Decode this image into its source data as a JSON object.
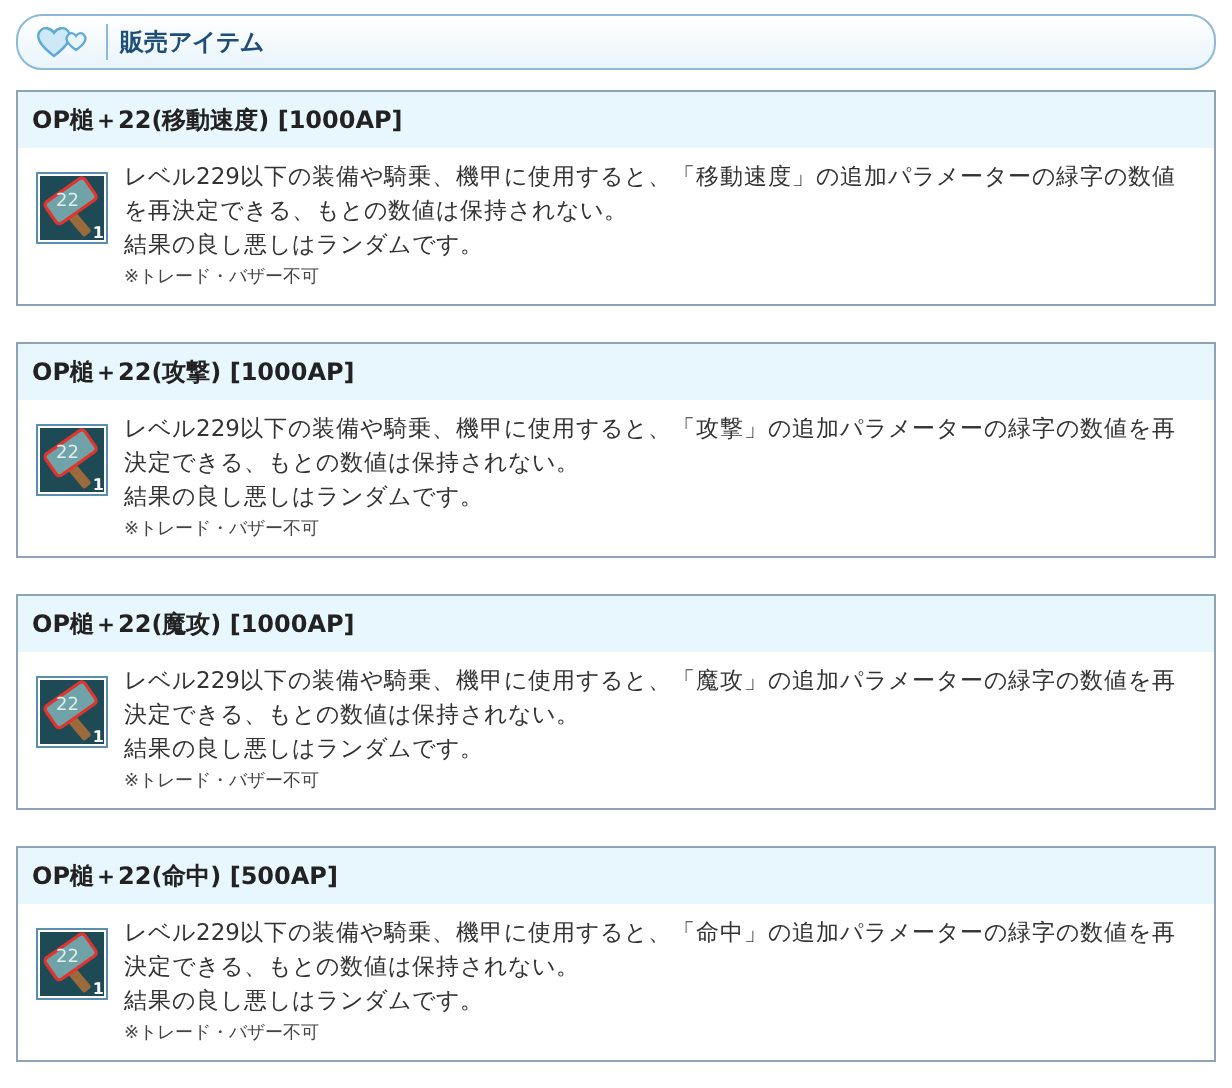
{
  "header": {
    "title": "販売アイテム"
  },
  "items": [
    {
      "title": "OP槌＋22(移動速度) [1000AP]",
      "icon_label": "22",
      "icon_count": "1",
      "description": "レベル229以下の装備や騎乗、機甲に使用すると、「移動速度」の追加パラメーターの緑字の数値を再決定できる、もとの数値は保持されない。",
      "note": "結果の良し悪しはランダムです。",
      "restriction": "※トレード・バザー不可"
    },
    {
      "title": "OP槌＋22(攻撃) [1000AP]",
      "icon_label": "22",
      "icon_count": "1",
      "description": "レベル229以下の装備や騎乗、機甲に使用すると、「攻撃」の追加パラメーターの緑字の数値を再決定できる、もとの数値は保持されない。",
      "note": "結果の良し悪しはランダムです。",
      "restriction": "※トレード・バザー不可"
    },
    {
      "title": "OP槌＋22(魔攻) [1000AP]",
      "icon_label": "22",
      "icon_count": "1",
      "description": "レベル229以下の装備や騎乗、機甲に使用すると、「魔攻」の追加パラメーターの緑字の数値を再決定できる、もとの数値は保持されない。",
      "note": "結果の良し悪しはランダムです。",
      "restriction": "※トレード・バザー不可"
    },
    {
      "title": "OP槌＋22(命中) [500AP]",
      "icon_label": "22",
      "icon_count": "1",
      "description": "レベル229以下の装備や騎乗、機甲に使用すると、「命中」の追加パラメーターの緑字の数値を再決定できる、もとの数値は保持されない。",
      "note": "結果の良し悪しはランダムです。",
      "restriction": "※トレード・バザー不可"
    }
  ]
}
